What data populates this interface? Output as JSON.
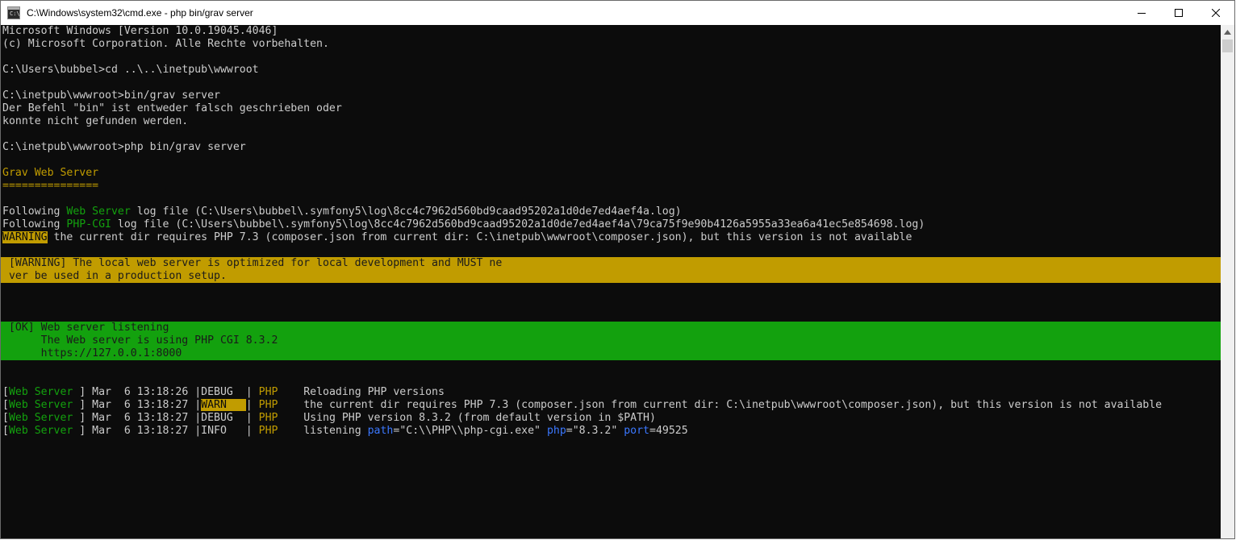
{
  "window": {
    "title": "C:\\Windows\\system32\\cmd.exe - php  bin/grav server",
    "app_icon_label": "C:\\",
    "icon_minimize": "minimize-icon",
    "icon_maximize": "maximize-icon",
    "icon_close": "close-icon"
  },
  "colors": {
    "background": "#0c0c0c",
    "text": "#cccccc",
    "yellow": "#c19c00",
    "green": "#13a10e",
    "blue": "#3b78ff"
  },
  "console": {
    "intro": [
      "Microsoft Windows [Version 10.0.19045.4046]",
      "(c) Microsoft Corporation. Alle Rechte vorbehalten.",
      "C:\\Users\\bubbel>cd ..\\..\\inetpub\\wwwroot",
      "C:\\inetpub\\wwwroot>bin/grav server",
      "Der Befehl \"bin\" ist entweder falsch geschrieben oder",
      "konnte nicht gefunden werden.",
      "C:\\inetpub\\wwwroot>php bin/grav server"
    ],
    "server_title": "Grav Web Server",
    "server_underline": "===============",
    "follow_lines": [
      {
        "prefix": "Following ",
        "name": "Web Server",
        "rest": " log file (C:\\Users\\bubbel\\.symfony5\\log\\8cc4c7962d560bd9caad95202a1d0de7ed4aef4a.log)"
      },
      {
        "prefix": "Following ",
        "name": "PHP-CGI",
        "rest": " log file (C:\\Users\\bubbel\\.symfony5\\log\\8cc4c7962d560bd9caad95202a1d0de7ed4aef4a\\79ca75f9e90b4126a5955a33ea6a41ec5e854698.log)"
      }
    ],
    "warning_label": "WARNING",
    "warning_text": " the current dir requires PHP 7.3 (composer.json from current dir: C:\\inetpub\\wwwroot\\composer.json), but this version is not available",
    "warn_block": [
      " [WARNING] The local web server is optimized for local development and MUST ne",
      " ver be used in a production setup."
    ],
    "ok_block": [
      " [OK] Web server listening",
      "      The Web server is using PHP CGI 8.3.2",
      "      https://127.0.0.1:8000"
    ],
    "log_rows": [
      {
        "open": "[",
        "source": "Web Server",
        "date": " ] Mar  6 13:18:26 |",
        "level": "DEBUG  ",
        "sep": "| ",
        "php": "PHP",
        "message": "    Reloading PHP versions"
      },
      {
        "open": "[",
        "source": "Web Server",
        "date": " ] Mar  6 13:18:27 |",
        "level": "WARN   ",
        "sep": "| ",
        "php": "PHP",
        "message": "    the current dir requires PHP 7.3 (composer.json from current dir: C:\\inetpub\\wwwroot\\composer.json), but this version is not available"
      },
      {
        "open": "[",
        "source": "Web Server",
        "date": " ] Mar  6 13:18:27 |",
        "level": "DEBUG  ",
        "sep": "| ",
        "php": "PHP",
        "message": "    Using PHP version 8.3.2 (from default version in $PATH)"
      },
      {
        "open": "[",
        "source": "Web Server",
        "date": " ] Mar  6 13:18:27 |",
        "level": "INFO   ",
        "sep": "| ",
        "php": "PHP",
        "message": "    listening ",
        "kv": [
          {
            "key": "path",
            "value": "=\"C:\\\\PHP\\\\php-cgi.exe\" "
          },
          {
            "key": "php",
            "value": "=\"8.3.2\" "
          },
          {
            "key": "port",
            "value": "=49525"
          }
        ]
      }
    ]
  },
  "scrollbar": {
    "up_icon": "scroll-up-arrow-icon"
  }
}
